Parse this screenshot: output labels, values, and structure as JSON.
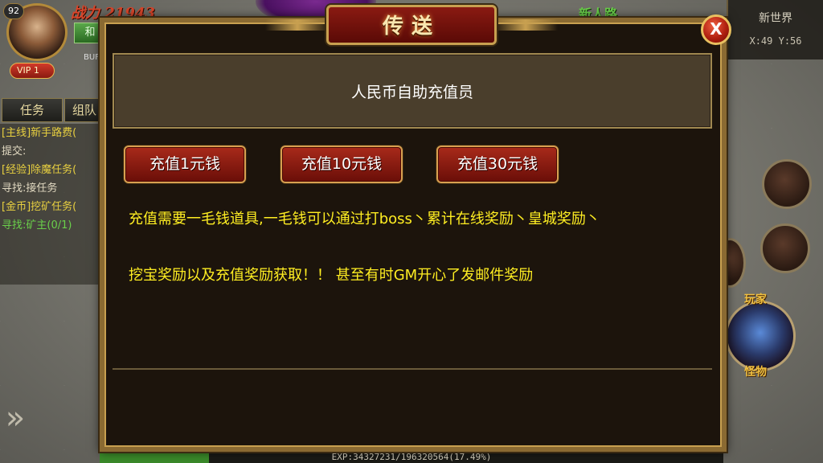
{
  "hud": {
    "level": "92",
    "vip": "VIP 1",
    "power_value": "战力 21943",
    "side_button": "和",
    "buff": "BUF",
    "tabs": [
      "任务",
      "组队"
    ],
    "tasks": [
      {
        "tag": "[主线]",
        "text": "新手路费(",
        "style": "yellow"
      },
      {
        "tag": "",
        "text": "提交:",
        "style": "white"
      },
      {
        "tag": "[经验]",
        "text": "除魔任务(",
        "style": "yellow"
      },
      {
        "tag": "",
        "text": "寻找:接任务",
        "style": "white"
      },
      {
        "tag": "[金币]",
        "text": "挖矿任务(",
        "style": "yellow"
      },
      {
        "tag": "",
        "text": "寻找:矿主(0/1)",
        "style": "green"
      }
    ]
  },
  "map": {
    "name": "新世界",
    "coords": "X:49 Y:56",
    "zone_label": "新人路"
  },
  "skills": {
    "label_top": "玩家",
    "label_bottom": "怪物"
  },
  "exp": {
    "text": "EXP:34327231/196320564(17.49%)",
    "progress": 17.49
  },
  "dialog": {
    "title": "传送",
    "close": "X",
    "header": "人民币自助充值员",
    "buttons": [
      "充值1元钱",
      "充值10元钱",
      "充值30元钱"
    ],
    "info_lines": [
      "充值需要一毛钱道具,一毛钱可以通过打boss丶累计在线奖励丶皇城奖励丶",
      "挖宝奖励以及充值奖励获取！！ 甚至有时GM开心了发邮件奖励"
    ]
  },
  "colors": {
    "info_text": "#ffee22",
    "button_red": "#a82a1a",
    "frame_gold": "#c8a050"
  }
}
